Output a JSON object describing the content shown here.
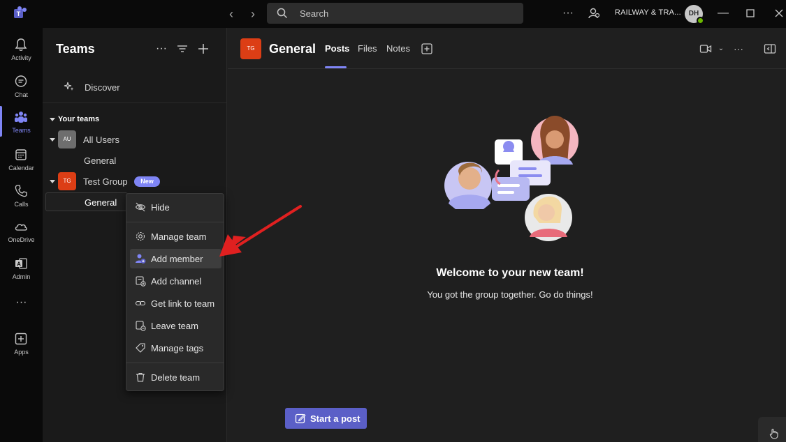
{
  "titlebar": {
    "search_placeholder": "Search",
    "org_name": "RAILWAY & TRA...",
    "avatar_initials": "DH"
  },
  "rail": {
    "items": [
      {
        "label": "Activity"
      },
      {
        "label": "Chat"
      },
      {
        "label": "Teams"
      },
      {
        "label": "Calendar"
      },
      {
        "label": "Calls"
      },
      {
        "label": "OneDrive"
      },
      {
        "label": "Admin"
      },
      {
        "label": "Apps"
      }
    ],
    "more_label": "···"
  },
  "panel": {
    "title": "Teams",
    "discover_label": "Discover",
    "section_label": "Your teams",
    "teams": [
      {
        "initials": "AU",
        "name": "All Users",
        "channels": [
          "General"
        ],
        "color": "#6e6e6e"
      },
      {
        "initials": "TG",
        "name": "Test Group",
        "channels": [
          "General"
        ],
        "badge": "New",
        "color": "#dc3e15"
      }
    ]
  },
  "context_menu": {
    "items": [
      {
        "label": "Hide"
      },
      {
        "label": "Manage team"
      },
      {
        "label": "Add member"
      },
      {
        "label": "Add channel"
      },
      {
        "label": "Get link to team"
      },
      {
        "label": "Leave team"
      },
      {
        "label": "Manage tags"
      },
      {
        "label": "Delete team"
      }
    ]
  },
  "channel_header": {
    "initials": "TG",
    "title": "General",
    "tabs": [
      "Posts",
      "Files",
      "Notes"
    ],
    "active_tab": "Posts"
  },
  "welcome": {
    "title": "Welcome to your new team!",
    "subtitle": "You got the group together. Go do things!"
  },
  "compose": {
    "start_post_label": "Start a post"
  },
  "colors": {
    "accent": "#7f85f5",
    "button": "#5b5fc7",
    "annotation_arrow": "#e02020"
  }
}
